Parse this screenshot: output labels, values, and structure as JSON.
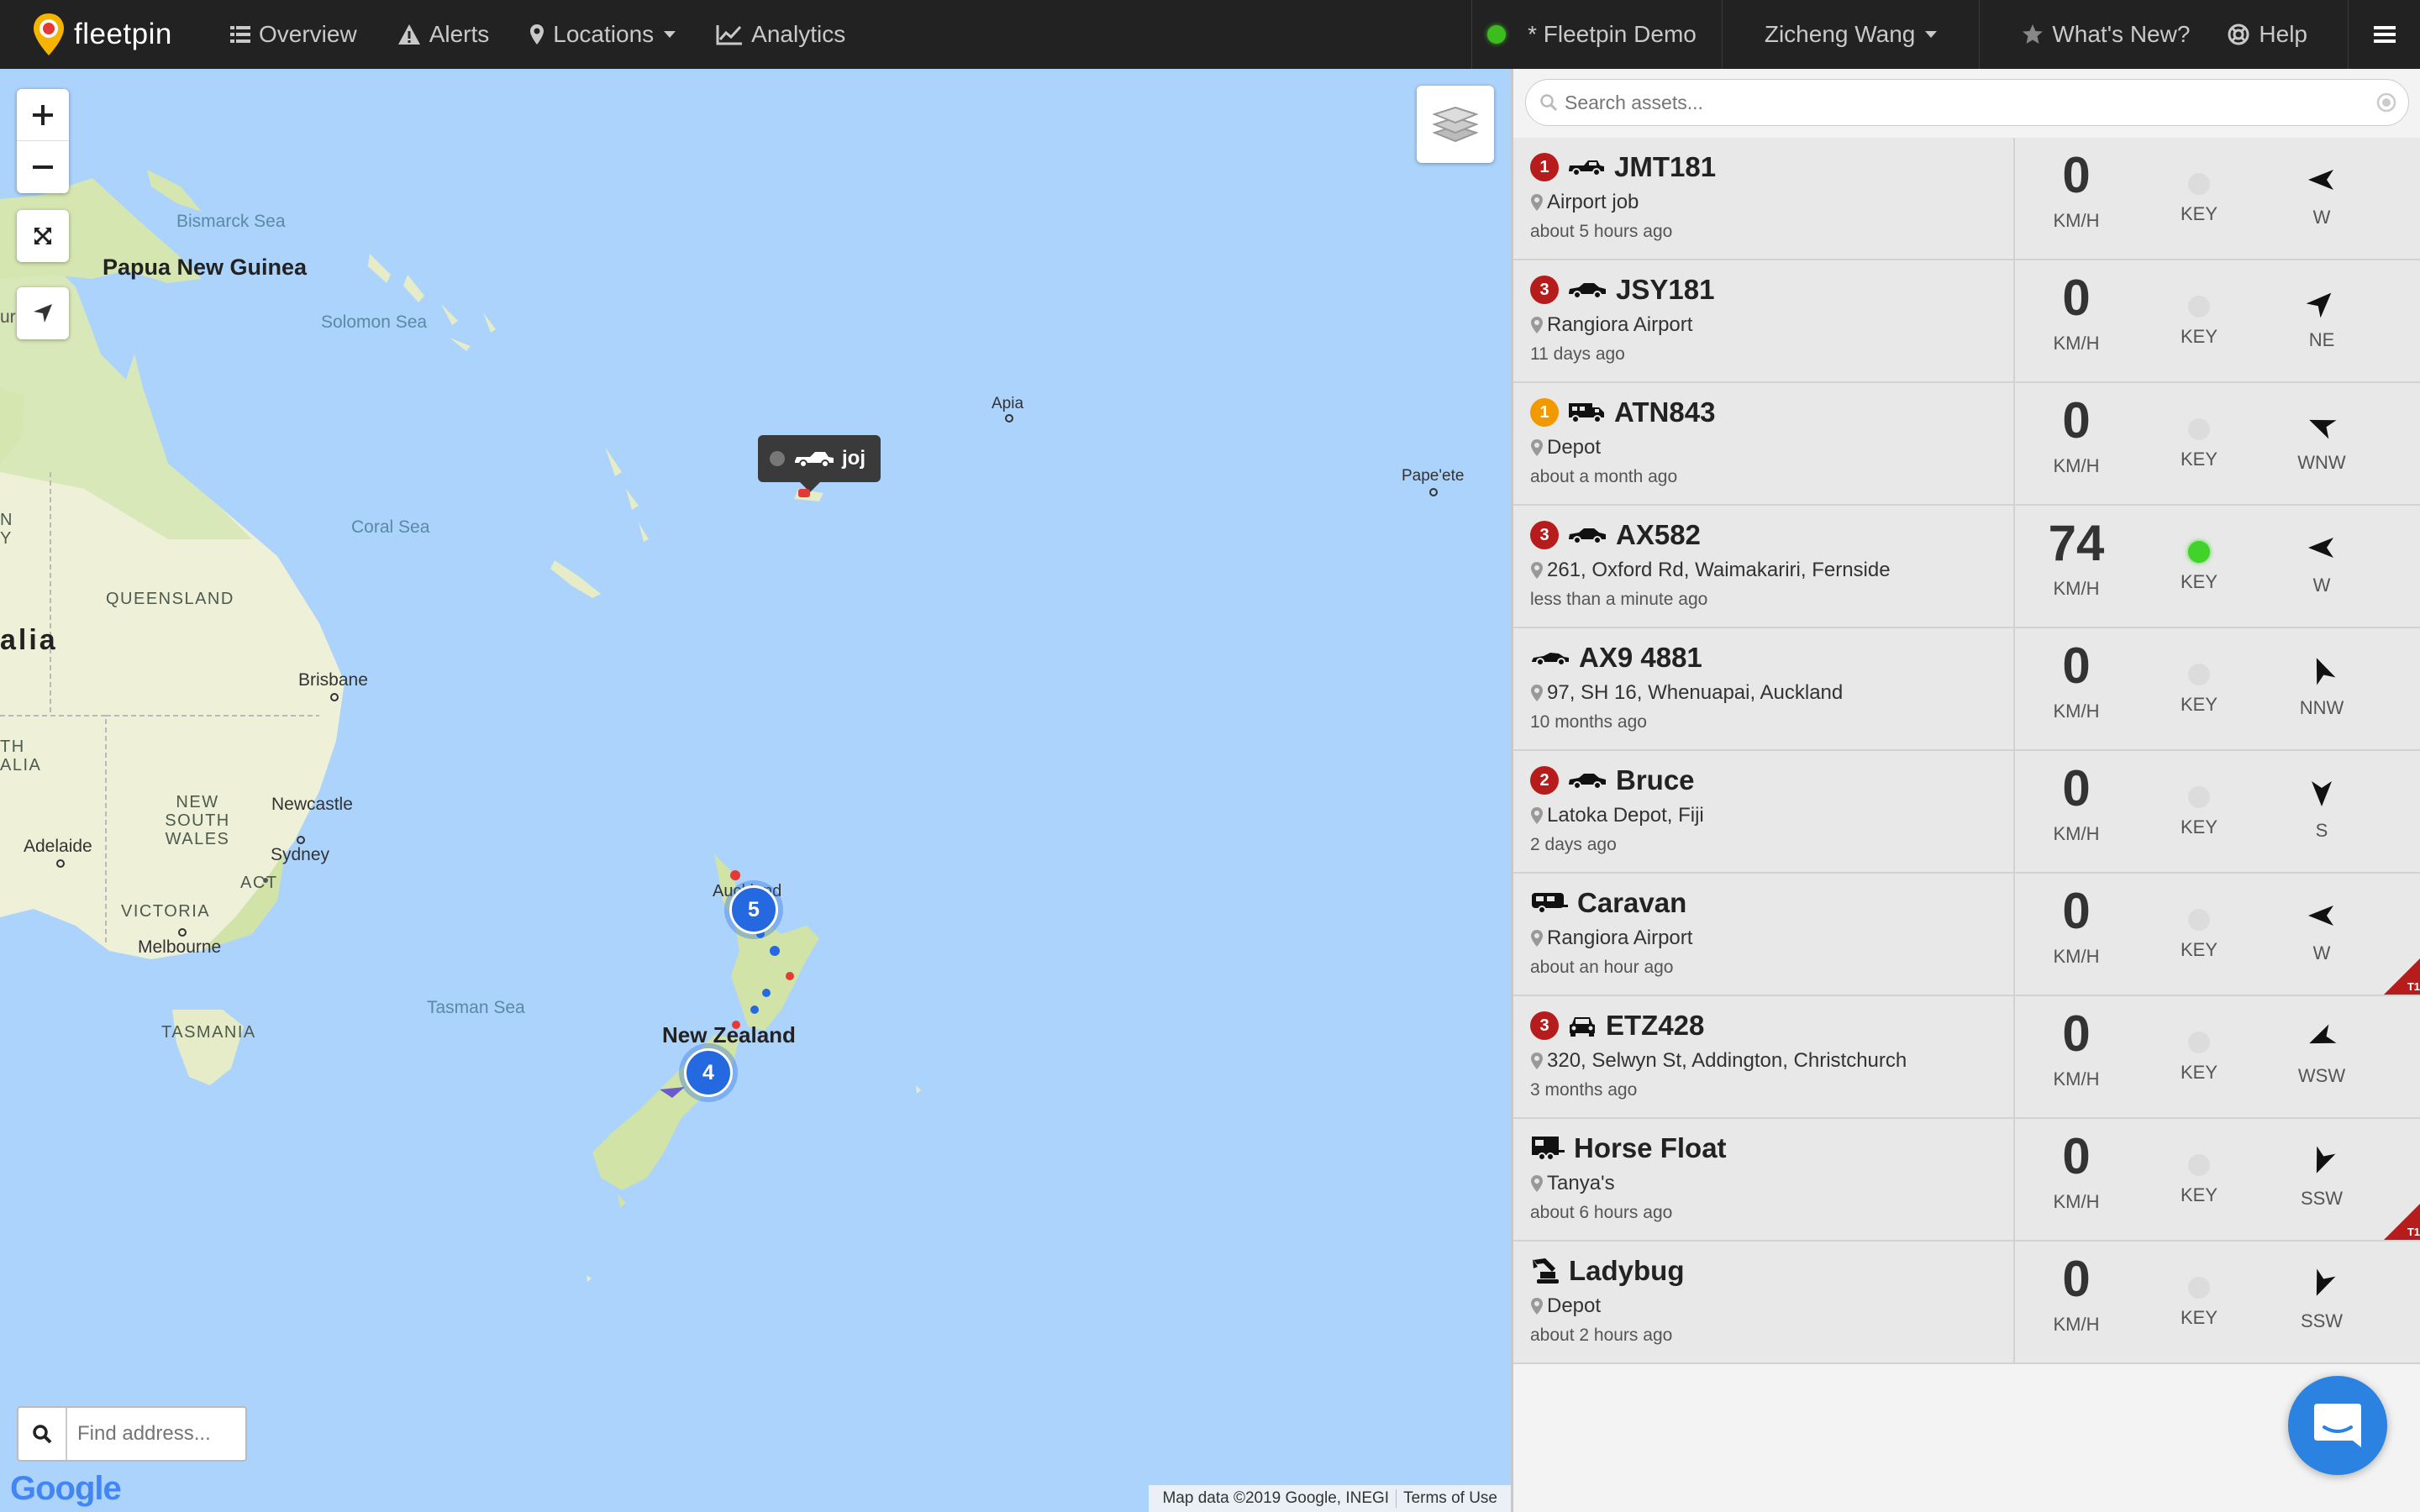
{
  "brand": {
    "name": "fleetpin"
  },
  "nav": {
    "overview": "Overview",
    "alerts": "Alerts",
    "locations": "Locations",
    "analytics": "Analytics",
    "account": "* Fleetpin Demo",
    "user": "Zicheng Wang",
    "whats_new": "What's New?",
    "help": "Help"
  },
  "colors": {
    "navbar": "#222222",
    "map_water": "#abd3fb",
    "status_online": "#3cbc1f",
    "badge_red": "#b71c1c",
    "badge_orange": "#f09a00",
    "cluster": "#2569e0",
    "chat": "#2c82e0"
  },
  "map": {
    "labels": {
      "bismarck_sea": "Bismarck Sea",
      "solomon_sea": "Solomon Sea",
      "coral_sea": "Coral Sea",
      "tasman_sea": "Tasman Sea",
      "papua_new_guinea": "Papua New Guinea",
      "queensland": "QUEENSLAND",
      "australia_partial": "alia",
      "new_south_wales": "NEW SOUTH WALES",
      "victoria": "VICTORIA",
      "tasmania": "TASMANIA",
      "act": "ACT",
      "brisbane": "Brisbane",
      "newcastle": "Newcastle",
      "sydney": "Sydney",
      "adelaide": "Adelaide",
      "melbourne": "Melbourne",
      "apia": "Apia",
      "papeete": "Pape'ete",
      "auckland": "Auckland",
      "new_zealand": "New Zealand",
      "edge_n": "N",
      "edge_y": "Y",
      "edge_th": "TH",
      "edge_alia": "ALIA",
      "edge_ur": "ur"
    },
    "clusters": {
      "north": "5",
      "south": "4"
    },
    "tooltip_label": "joj",
    "find_address_placeholder": "Find address...",
    "google": "Google",
    "attribution": "Map data ©2019 Google, INEGI",
    "terms": "Terms of Use"
  },
  "panel": {
    "search_placeholder": "Search assets...",
    "speed_unit": "KM/H",
    "key_label": "KEY",
    "assets": [
      {
        "name": "JMT181",
        "badge": "1",
        "badge_color": "#b71c1c",
        "icon": "ute-icon",
        "location": "Airport job",
        "time": "about 5 hours ago",
        "speed": "0",
        "key_on": false,
        "direction": "W",
        "trailer": ""
      },
      {
        "name": "JSY181",
        "badge": "3",
        "badge_color": "#b71c1c",
        "icon": "car-icon",
        "location": "Rangiora Airport",
        "time": "11 days ago",
        "speed": "0",
        "key_on": false,
        "direction": "NE",
        "trailer": ""
      },
      {
        "name": "ATN843",
        "badge": "1",
        "badge_color": "#f09a00",
        "icon": "truck-icon",
        "location": "Depot",
        "time": "about a month ago",
        "speed": "0",
        "key_on": false,
        "direction": "WNW",
        "trailer": ""
      },
      {
        "name": "AX582",
        "badge": "3",
        "badge_color": "#b71c1c",
        "icon": "car-icon",
        "location": "261, Oxford Rd, Waimakariri, Fernside",
        "time": "less than a minute ago",
        "speed": "74",
        "key_on": true,
        "direction": "W",
        "trailer": ""
      },
      {
        "name": "AX9 4881",
        "badge": "",
        "badge_color": "",
        "icon": "sports-car-icon",
        "location": "97, SH 16, Whenuapai, Auckland",
        "time": "10 months ago",
        "speed": "0",
        "key_on": false,
        "direction": "NNW",
        "trailer": ""
      },
      {
        "name": "Bruce",
        "badge": "2",
        "badge_color": "#b71c1c",
        "icon": "car-icon",
        "location": "Latoka Depot, Fiji",
        "time": "2 days ago",
        "speed": "0",
        "key_on": false,
        "direction": "S",
        "trailer": ""
      },
      {
        "name": "Caravan",
        "badge": "",
        "badge_color": "",
        "icon": "caravan-icon",
        "location": "Rangiora Airport",
        "time": "about an hour ago",
        "speed": "0",
        "key_on": false,
        "direction": "W",
        "trailer": "T1"
      },
      {
        "name": "ETZ428",
        "badge": "3",
        "badge_color": "#b71c1c",
        "icon": "car-front-icon",
        "location": "320, Selwyn St, Addington, Christchurch",
        "time": "3 months ago",
        "speed": "0",
        "key_on": false,
        "direction": "WSW",
        "trailer": ""
      },
      {
        "name": "Horse Float",
        "badge": "",
        "badge_color": "",
        "icon": "horse-float-icon",
        "location": "Tanya's",
        "time": "about 6 hours ago",
        "speed": "0",
        "key_on": false,
        "direction": "SSW",
        "trailer": "T1"
      },
      {
        "name": "Ladybug",
        "badge": "",
        "badge_color": "",
        "icon": "excavator-icon",
        "location": "Depot",
        "time": "about 2 hours ago",
        "speed": "0",
        "key_on": false,
        "direction": "SSW",
        "trailer": ""
      }
    ]
  }
}
